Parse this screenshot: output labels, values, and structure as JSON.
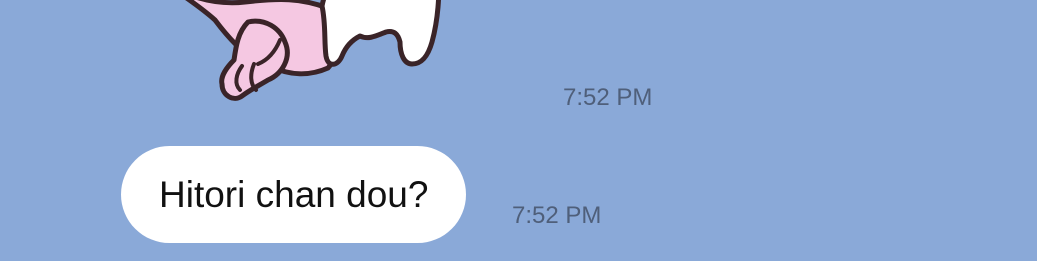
{
  "chat": {
    "messages": [
      {
        "type": "sticker",
        "sticker_icon": "bunny-sticker-icon",
        "time": "7:52 PM"
      },
      {
        "type": "text",
        "text": "Hitori chan dou?",
        "time": "7:52 PM"
      }
    ]
  },
  "colors": {
    "background": "#8aa9d8",
    "bubble": "#ffffff",
    "timestamp": "#4f5f7a",
    "sticker_pink": "#f5c8e2",
    "sticker_outline": "#3a2428"
  }
}
